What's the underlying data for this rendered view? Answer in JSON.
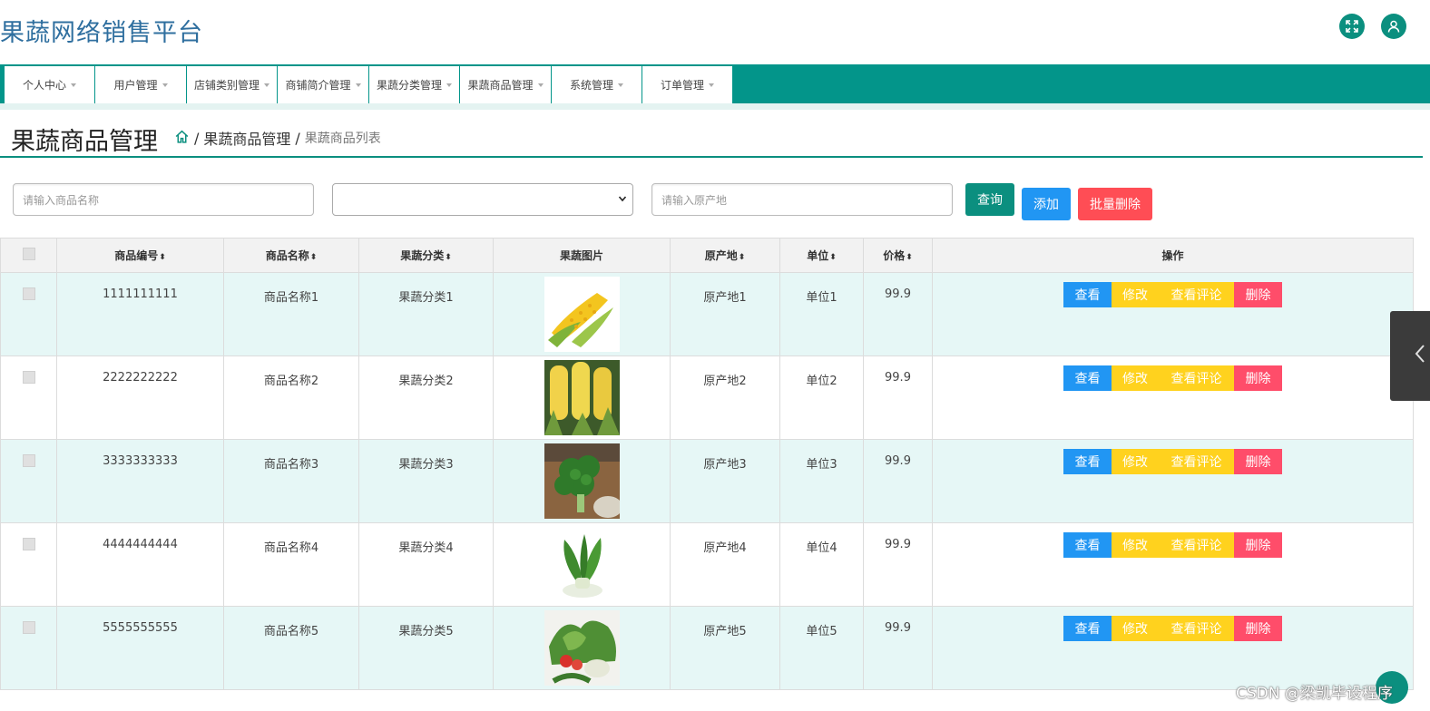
{
  "app": {
    "title": "果蔬网络销售平台",
    "icons": [
      "fullscreen-icon",
      "user-icon"
    ],
    "accent_color": "#03958a"
  },
  "nav": {
    "items": [
      {
        "label": "个人中心"
      },
      {
        "label": "用户管理"
      },
      {
        "label": "店铺类别管理"
      },
      {
        "label": "商铺简介管理"
      },
      {
        "label": "果蔬分类管理"
      },
      {
        "label": "果蔬商品管理"
      },
      {
        "label": "系统管理"
      },
      {
        "label": "订单管理"
      }
    ]
  },
  "page": {
    "heading": "果蔬商品管理",
    "breadcrumb": {
      "icon": "home-icon",
      "separator": "/",
      "parent": "果蔬商品管理",
      "current": "果蔬商品列表"
    }
  },
  "search": {
    "name_placeholder": "请输入商品名称",
    "category_value": "",
    "origin_placeholder": "请输入原产地",
    "query_label": "查询",
    "add_label": "添加",
    "batch_delete_label": "批量删除"
  },
  "table": {
    "sort_glyph": "⬍",
    "headers": [
      "商品编号",
      "商品名称",
      "果蔬分类",
      "果蔬图片",
      "原产地",
      "单位",
      "价格",
      "操作"
    ],
    "actions": [
      "查看",
      "修改",
      "查看评论",
      "删除"
    ],
    "action_colors": [
      "#2196f3",
      "#ffd21e",
      "#ffd21e",
      "#ff4d6a"
    ],
    "rows": [
      {
        "id": "1111111111",
        "name": "商品名称1",
        "category": "果蔬分类1",
        "image": "corn-cob-image",
        "origin": "原产地1",
        "unit": "单位1",
        "price": "99.9"
      },
      {
        "id": "2222222222",
        "name": "商品名称2",
        "category": "果蔬分类2",
        "image": "corn-field-image",
        "origin": "原产地2",
        "unit": "单位2",
        "price": "99.9"
      },
      {
        "id": "3333333333",
        "name": "商品名称3",
        "category": "果蔬分类3",
        "image": "broccoli-image",
        "origin": "原产地3",
        "unit": "单位3",
        "price": "99.9"
      },
      {
        "id": "4444444444",
        "name": "商品名称4",
        "category": "果蔬分类4",
        "image": "bok-choy-image",
        "origin": "原产地4",
        "unit": "单位4",
        "price": "99.9"
      },
      {
        "id": "5555555555",
        "name": "商品名称5",
        "category": "果蔬分类5",
        "image": "mixed-vegetables-image",
        "origin": "原产地5",
        "unit": "单位5",
        "price": "99.9"
      }
    ]
  },
  "watermark": "CSDN @梁凯毕设程序"
}
